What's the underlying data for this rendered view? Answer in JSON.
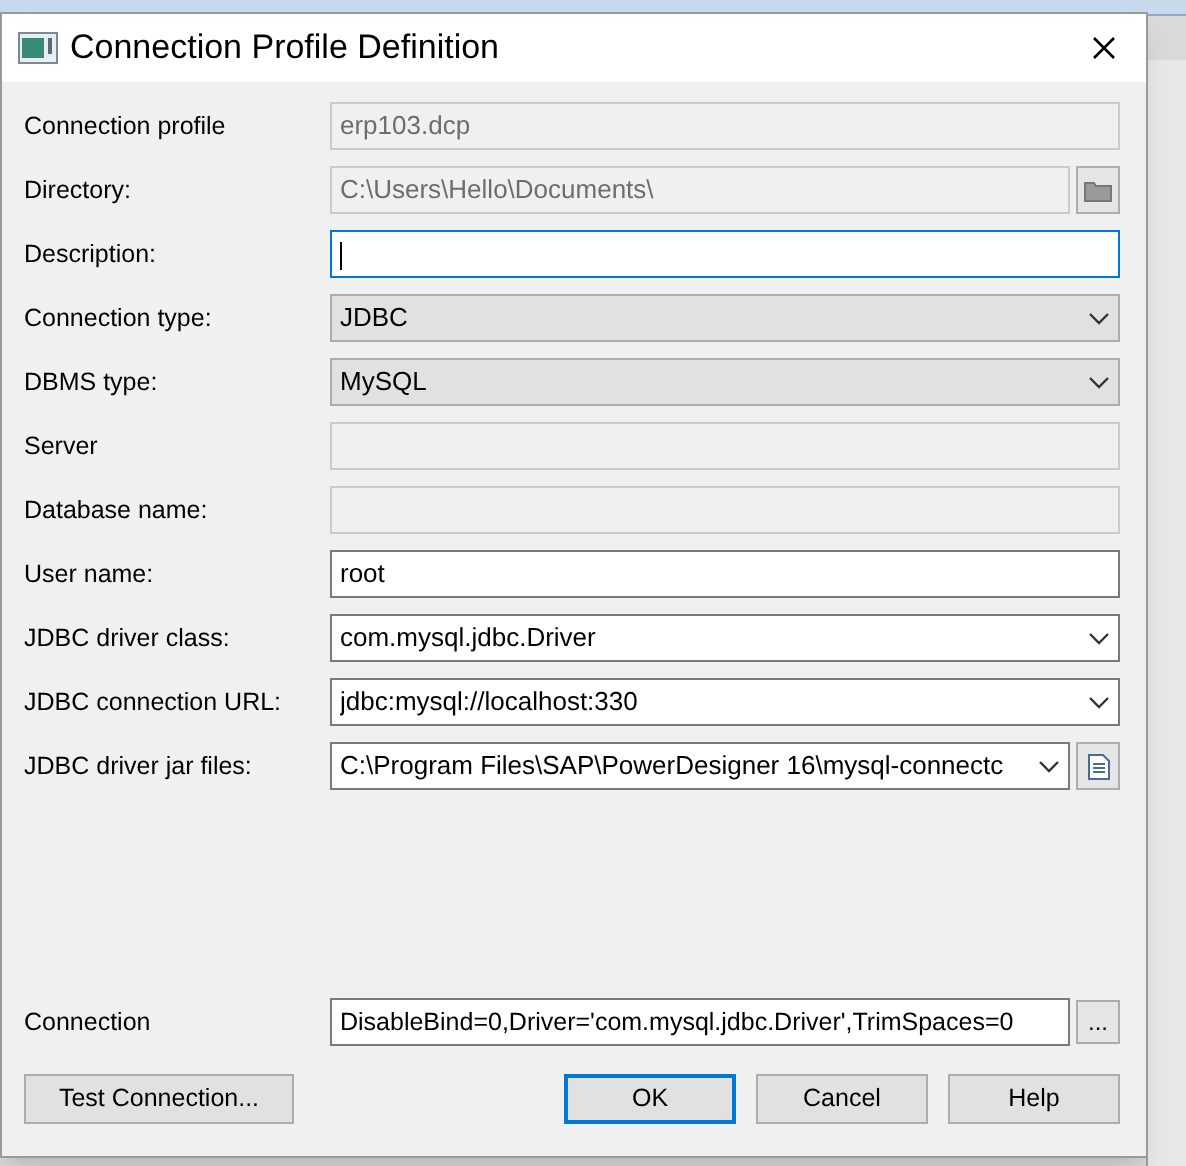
{
  "window": {
    "title": "Connection Profile Definition"
  },
  "fields": [
    {
      "label": "Connection profile",
      "kind": "text",
      "value": "erp103.dcp",
      "disabled": true,
      "focused": false
    },
    {
      "label": "Directory:",
      "kind": "text",
      "value": "C:\\Users\\Hello\\Documents\\",
      "disabled": true,
      "focused": false,
      "button": {
        "kind": "folder"
      }
    },
    {
      "label": "Description:",
      "kind": "text",
      "disabled": false,
      "focused": true
    },
    {
      "label": "Connection type:",
      "kind": "combo",
      "value": "JDBC",
      "disabled": true,
      "focused": false
    },
    {
      "label": "DBMS type:",
      "kind": "combo",
      "value": "MySQL",
      "disabled": true,
      "focused": false
    },
    {
      "label": "Server",
      "kind": "text",
      "disabled": true,
      "focused": false
    },
    {
      "label": "Database name:",
      "kind": "text",
      "disabled": true,
      "focused": false
    },
    {
      "label": "User name:",
      "kind": "text",
      "value": "root",
      "disabled": false,
      "focused": false
    },
    {
      "label": "JDBC driver class:",
      "kind": "combo",
      "value": "com.mysql.jdbc.Driver",
      "disabled": false,
      "focused": false
    },
    {
      "label": "JDBC connection URL:",
      "kind": "combo",
      "value": "jdbc:mysql://localhost:330",
      "disabled": false,
      "focused": false
    },
    {
      "label": "JDBC driver jar files:",
      "kind": "combo",
      "value": "C:\\Program Files\\SAP\\PowerDesigner 16\\mysql-connectc",
      "disabled": false,
      "focused": false,
      "button": {
        "kind": "file"
      }
    }
  ],
  "connection": {
    "label": "Connection",
    "value": "DisableBind=0,Driver='com.mysql.jdbc.Driver',TrimSpaces=0",
    "button": "..."
  },
  "buttons": [
    {
      "label": "Test Connection...",
      "default": false
    },
    {
      "label": "OK",
      "default": true
    },
    {
      "label": "Cancel",
      "default": false
    },
    {
      "label": "Help",
      "default": false
    }
  ]
}
